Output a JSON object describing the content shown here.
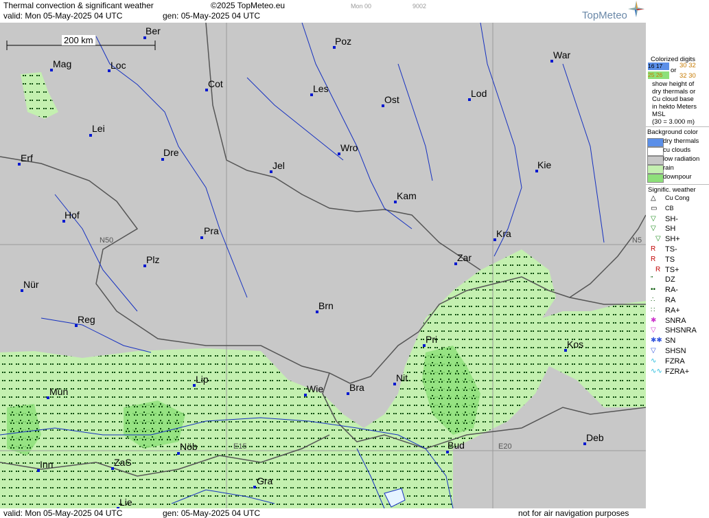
{
  "header": {
    "title": "Thermal convection & significant weather",
    "copyright": "©2025 TopMeteo.eu",
    "valid": "valid:  Mon  05-May-2025  04 UTC",
    "gen": "gen: 05-May-2025 04 UTC",
    "small_a": "Mon 00",
    "small_b": "9002",
    "brand": "TopMeteo"
  },
  "footer": {
    "valid": "valid:  Mon  05-May-2025  04 UTC",
    "gen": "gen: 05-May-2025 04 UTC",
    "note": "not for air navigation purposes"
  },
  "map": {
    "scale_label": "200 km",
    "grid_labels": {
      "n50_left": "N50",
      "n50_right": "N5",
      "e15": "E15",
      "e20": "E20"
    },
    "cities": [
      {
        "name": "Ber"
      },
      {
        "name": "Poz"
      },
      {
        "name": "War"
      },
      {
        "name": "Mag"
      },
      {
        "name": "Loc"
      },
      {
        "name": "Cot"
      },
      {
        "name": "Les"
      },
      {
        "name": "Ost"
      },
      {
        "name": "Lod"
      },
      {
        "name": "Lei"
      },
      {
        "name": "Dre"
      },
      {
        "name": "Erf"
      },
      {
        "name": "Wro"
      },
      {
        "name": "Jel"
      },
      {
        "name": "Kie"
      },
      {
        "name": "Kam"
      },
      {
        "name": "Hof"
      },
      {
        "name": "Pra"
      },
      {
        "name": "Kra"
      },
      {
        "name": "Zar"
      },
      {
        "name": "Plz"
      },
      {
        "name": "Nür"
      },
      {
        "name": "Brn"
      },
      {
        "name": "Reg"
      },
      {
        "name": "Pri"
      },
      {
        "name": "Kos"
      },
      {
        "name": "Lip"
      },
      {
        "name": "Nit"
      },
      {
        "name": "Mün"
      },
      {
        "name": "Wie"
      },
      {
        "name": "Bra"
      },
      {
        "name": "Nöb"
      },
      {
        "name": "Bud"
      },
      {
        "name": "Deb"
      },
      {
        "name": "Inn"
      },
      {
        "name": "ZaS"
      },
      {
        "name": "Gra"
      },
      {
        "name": "Lie"
      }
    ]
  },
  "legend": {
    "colorized_title": "Colorized digits",
    "digits_a": "16 17",
    "digits_b": "25 26",
    "or": "or",
    "digits_c": "30 32",
    "digits_d": "32 30",
    "desc": [
      "show height of",
      "dry thermals or",
      "Cu cloud base",
      "in hekto Meters",
      "MSL",
      "(30 = 3.000 m)"
    ],
    "bg_title": "Background color",
    "bg_items": [
      {
        "label": "dry thermals",
        "color": "#5b8fe8"
      },
      {
        "label": "cu clouds",
        "color": "#ffffff"
      },
      {
        "label": "low radiation",
        "color": "#c8c8c8"
      },
      {
        "label": "rain",
        "color": "#c4f0b0"
      },
      {
        "label": "downpour",
        "color": "#8ee07a"
      }
    ],
    "sig_title": "Signific. weather",
    "sig_items": [
      {
        "label": "Cu Cong",
        "icon": "cu-cong-icon",
        "sym": "△",
        "color": "#000"
      },
      {
        "label": "CB",
        "icon": "cb-icon",
        "sym": "▭",
        "color": "#000"
      },
      {
        "label": "SH-",
        "icon": "shower-light-icon",
        "sym": "▽",
        "color": "#1a8a1a"
      },
      {
        "label": "SH",
        "icon": "shower-icon",
        "sym": "▽",
        "color": "#1a8a1a"
      },
      {
        "label": "SH+",
        "icon": "shower-heavy-icon",
        "sym": "▽",
        "color": "#1a8a1a"
      },
      {
        "label": "TS-",
        "icon": "thunderstorm-light-icon",
        "sym": "R",
        "color": "#c00000"
      },
      {
        "label": "TS",
        "icon": "thunderstorm-icon",
        "sym": "R",
        "color": "#c00000"
      },
      {
        "label": "TS+",
        "icon": "thunderstorm-heavy-icon",
        "sym": "R",
        "color": "#c00000"
      },
      {
        "label": "DZ",
        "icon": "drizzle-icon",
        "sym": "”",
        "color": "#0a5a0a"
      },
      {
        "label": "RA-",
        "icon": "rain-light-icon",
        "sym": "••",
        "color": "#0a5a0a"
      },
      {
        "label": "RA",
        "icon": "rain-icon",
        "sym": "∴",
        "color": "#0a5a0a"
      },
      {
        "label": "RA+",
        "icon": "rain-heavy-icon",
        "sym": "∷",
        "color": "#0a5a0a"
      },
      {
        "label": "SNRA",
        "icon": "snow-rain-icon",
        "sym": "✱",
        "color": "#cc33cc"
      },
      {
        "label": "SHSNRA",
        "icon": "snow-rain-shower-icon",
        "sym": "▽",
        "color": "#cc33cc"
      },
      {
        "label": "SN",
        "icon": "snow-icon",
        "sym": "✱✱",
        "color": "#3355dd"
      },
      {
        "label": "SHSN",
        "icon": "snow-shower-icon",
        "sym": "▽",
        "color": "#3355dd"
      },
      {
        "label": "FZRA",
        "icon": "freezing-rain-icon",
        "sym": "∿",
        "color": "#22bbdd"
      },
      {
        "label": "FZRA+",
        "icon": "freezing-rain-heavy-icon",
        "sym": "∿∿",
        "color": "#22bbdd"
      }
    ]
  }
}
